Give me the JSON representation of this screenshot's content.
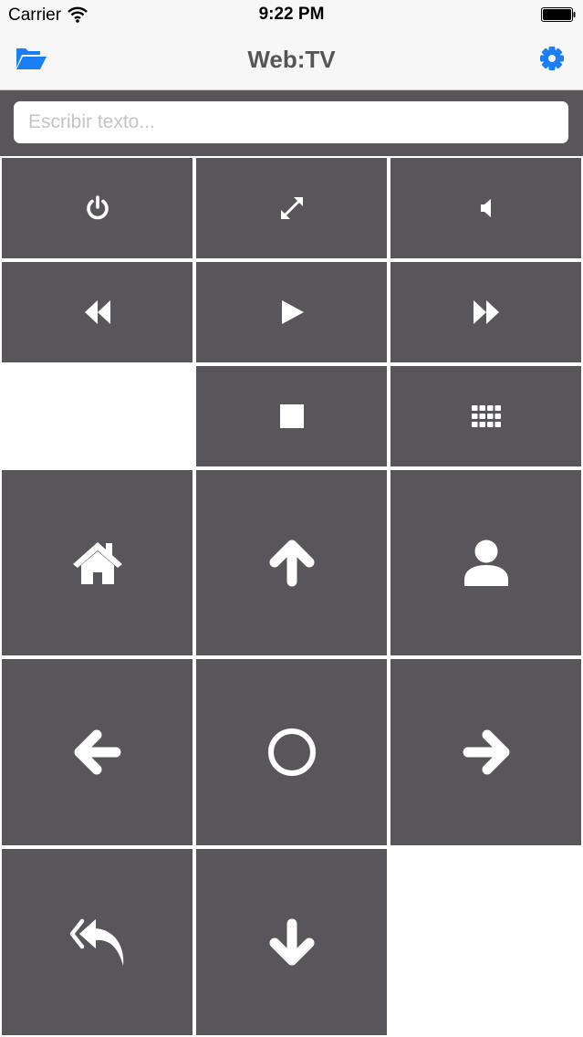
{
  "status_bar": {
    "carrier": "Carrier",
    "time": "9:22 PM"
  },
  "nav": {
    "title": "Web:TV",
    "left_icon": "folder-open-icon",
    "right_icon": "gear-icon",
    "accent_color": "#1a7ef5"
  },
  "search": {
    "placeholder": "Escribir texto...",
    "value": ""
  },
  "remote": {
    "tile_color": "#58565a",
    "buttons": [
      {
        "icon": "power-icon"
      },
      {
        "icon": "fullscreen-icon"
      },
      {
        "icon": "volume-icon"
      },
      {
        "icon": "rewind-icon"
      },
      {
        "icon": "play-icon"
      },
      {
        "icon": "fast-forward-icon"
      },
      {
        "icon": "stop-icon"
      },
      {
        "icon": "keypad-grid-icon"
      },
      {
        "icon": "home-icon"
      },
      {
        "icon": "arrow-up-icon"
      },
      {
        "icon": "user-icon"
      },
      {
        "icon": "arrow-left-icon"
      },
      {
        "icon": "ok-circle-icon"
      },
      {
        "icon": "arrow-right-icon"
      },
      {
        "icon": "reply-all-back-icon"
      },
      {
        "icon": "arrow-down-icon"
      }
    ]
  }
}
